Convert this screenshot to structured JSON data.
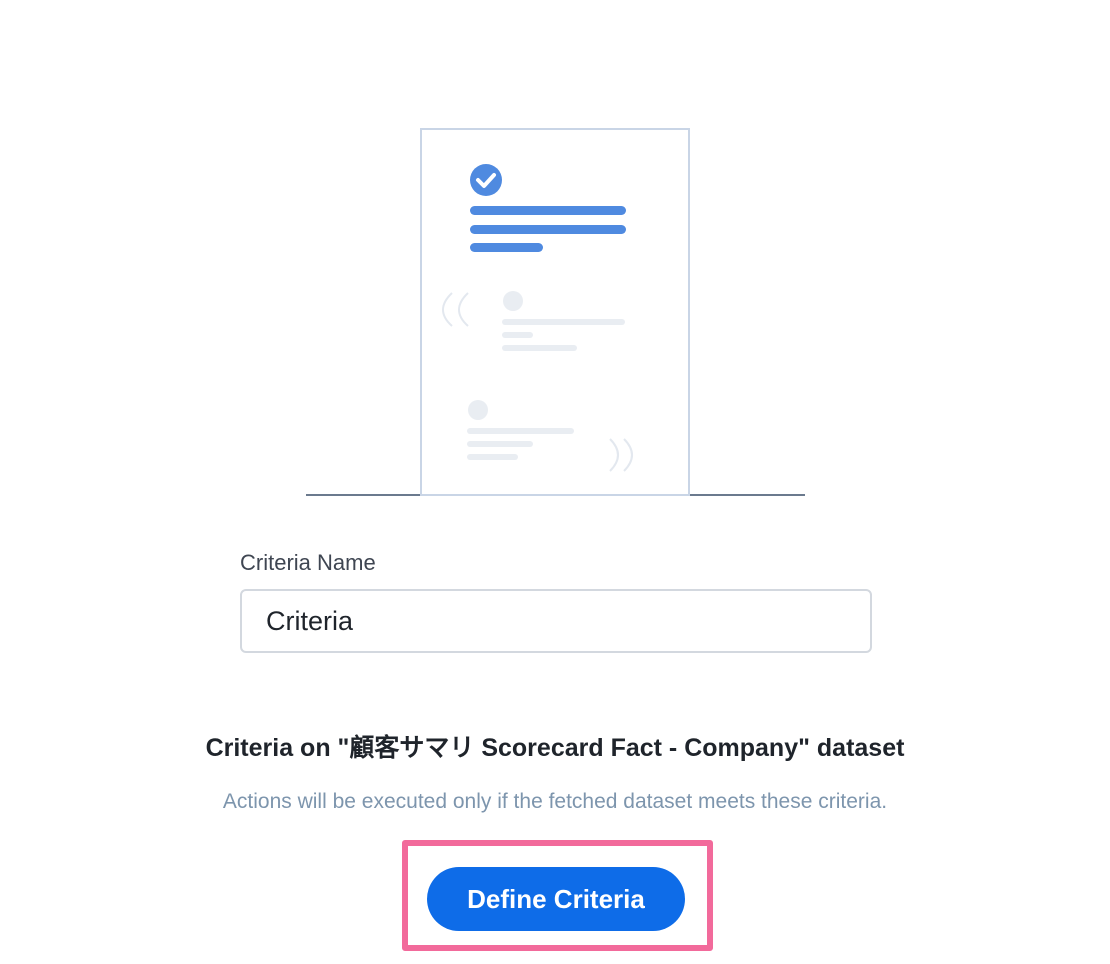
{
  "criteria_name": {
    "label": "Criteria Name",
    "value": "Criteria",
    "placeholder": ""
  },
  "dataset": {
    "title": "Criteria on \"顧客サマリ Scorecard Fact - Company\" dataset",
    "subtitle": "Actions will be executed only if the fetched dataset meets these criteria."
  },
  "actions": {
    "define_label": "Define Criteria"
  },
  "colors": {
    "accent": "#0e6ce8",
    "highlight": "#f26a9b",
    "illustration_blue": "#4f8ae0",
    "illustration_gray": "#e9edf2"
  },
  "icons": {
    "status": "check-circle-icon"
  }
}
